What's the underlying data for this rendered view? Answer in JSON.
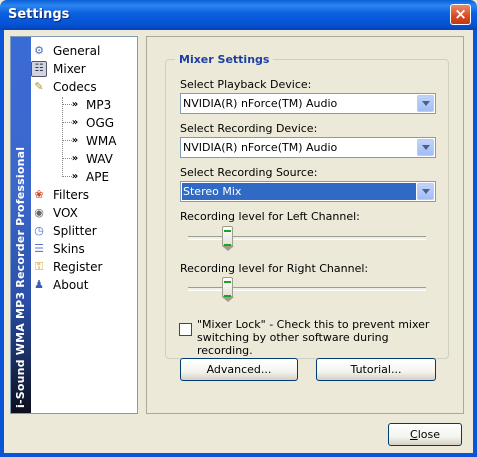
{
  "window": {
    "title": "Settings",
    "close_glyph": "×"
  },
  "sidebar": {
    "strip_text": "i-Sound WMA MP3 Recorder Professional",
    "items": [
      {
        "label": "General",
        "icon": "gear-icon"
      },
      {
        "label": "Mixer",
        "icon": "mixer-icon"
      },
      {
        "label": "Codecs",
        "icon": "codecs-icon"
      },
      {
        "label": "MP3",
        "icon": "arrow-right-icon"
      },
      {
        "label": "OGG",
        "icon": "arrow-right-icon"
      },
      {
        "label": "WMA",
        "icon": "arrow-right-icon"
      },
      {
        "label": "WAV",
        "icon": "arrow-right-icon"
      },
      {
        "label": "APE",
        "icon": "arrow-right-icon"
      },
      {
        "label": "Filters",
        "icon": "filters-icon"
      },
      {
        "label": "VOX",
        "icon": "vox-icon"
      },
      {
        "label": "Splitter",
        "icon": "splitter-icon"
      },
      {
        "label": "Skins",
        "icon": "skins-icon"
      },
      {
        "label": "Register",
        "icon": "key-icon"
      },
      {
        "label": "About",
        "icon": "people-icon"
      }
    ]
  },
  "mixer": {
    "group_title": "Mixer Settings",
    "playback_label": "Select Playback Device:",
    "playback_value": "NVIDIA(R) nForce(TM) Audio",
    "recording_device_label": "Select Recording Device:",
    "recording_device_value": "NVIDIA(R) nForce(TM) Audio",
    "recording_source_label": "Select Recording Source:",
    "recording_source_value": "Stereo Mix",
    "left_level_label": "Recording level for Left Channel:",
    "left_level": 0.15,
    "right_level_label": "Recording level for Right Channel:",
    "right_level": 0.15,
    "mixer_lock_label": "\"Mixer Lock\" - Check this to prevent mixer switching by other software during recording.",
    "mixer_lock_checked": false,
    "advanced_button": "Advanced...",
    "tutorial_button": "Tutorial..."
  },
  "footer": {
    "close_button": "Close"
  },
  "colors": {
    "titlebar": "#0a5fd8",
    "group_title": "#1e3f9f",
    "selection": "#316ac5"
  }
}
